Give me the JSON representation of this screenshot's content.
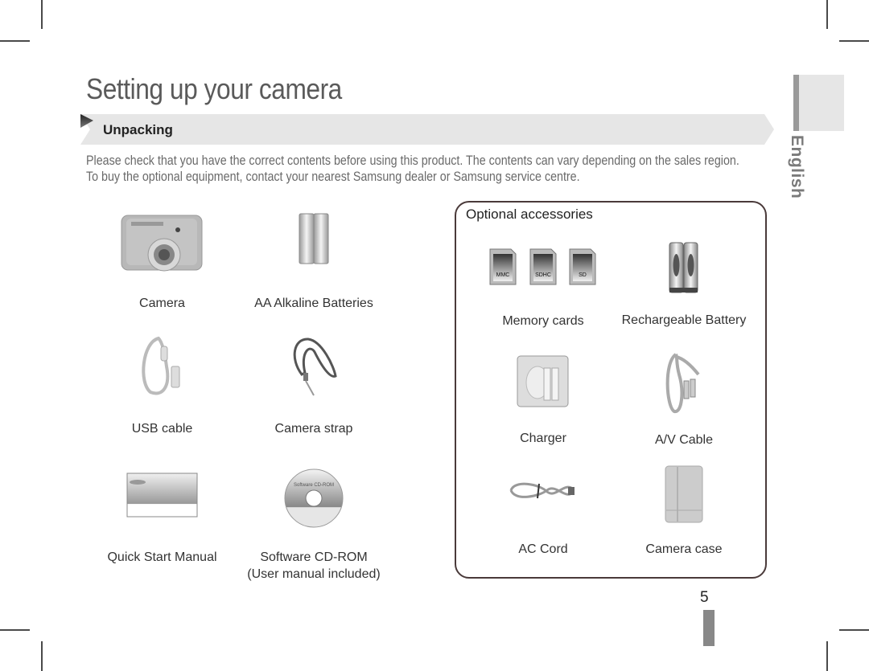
{
  "page": {
    "title": "Setting up your camera",
    "section": "Unpacking",
    "intro_line1": "Please check that you have the correct contents before using this product. The contents can vary depending on the sales region.",
    "intro_line2": "To buy the optional equipment, contact your nearest Samsung dealer or Samsung service centre.",
    "language_tab": "English",
    "page_number": "5"
  },
  "included_items": [
    {
      "label": "Camera",
      "icon": "camera-icon"
    },
    {
      "label": "AA Alkaline Batteries",
      "icon": "batteries-icon"
    },
    {
      "label": "USB cable",
      "icon": "usb-cable-icon"
    },
    {
      "label": "Camera strap",
      "icon": "strap-icon"
    },
    {
      "label": "Quick Start Manual",
      "icon": "manual-icon"
    },
    {
      "label": "Software CD-ROM",
      "sublabel": "(User manual included)",
      "icon": "cd-rom-icon",
      "disc_text": "Software CD-ROM"
    }
  ],
  "optional": {
    "title": "Optional accessories",
    "items": [
      {
        "label": "Memory cards",
        "icon": "memory-cards-icon",
        "cards": [
          "MMC",
          "SDHC",
          "SD"
        ]
      },
      {
        "label": "Rechargeable Battery",
        "icon": "rechargeable-battery-icon"
      },
      {
        "label": "Charger",
        "icon": "charger-icon"
      },
      {
        "label": "A/V Cable",
        "icon": "av-cable-icon"
      },
      {
        "label": "AC Cord",
        "icon": "ac-cord-icon"
      },
      {
        "label": "Camera case",
        "icon": "camera-case-icon"
      }
    ]
  },
  "colors": {
    "banner": "#e6e6e6",
    "title": "#5a5a5a",
    "box_border": "#4a3a3a",
    "tab_bar": "#9a9a9a"
  }
}
